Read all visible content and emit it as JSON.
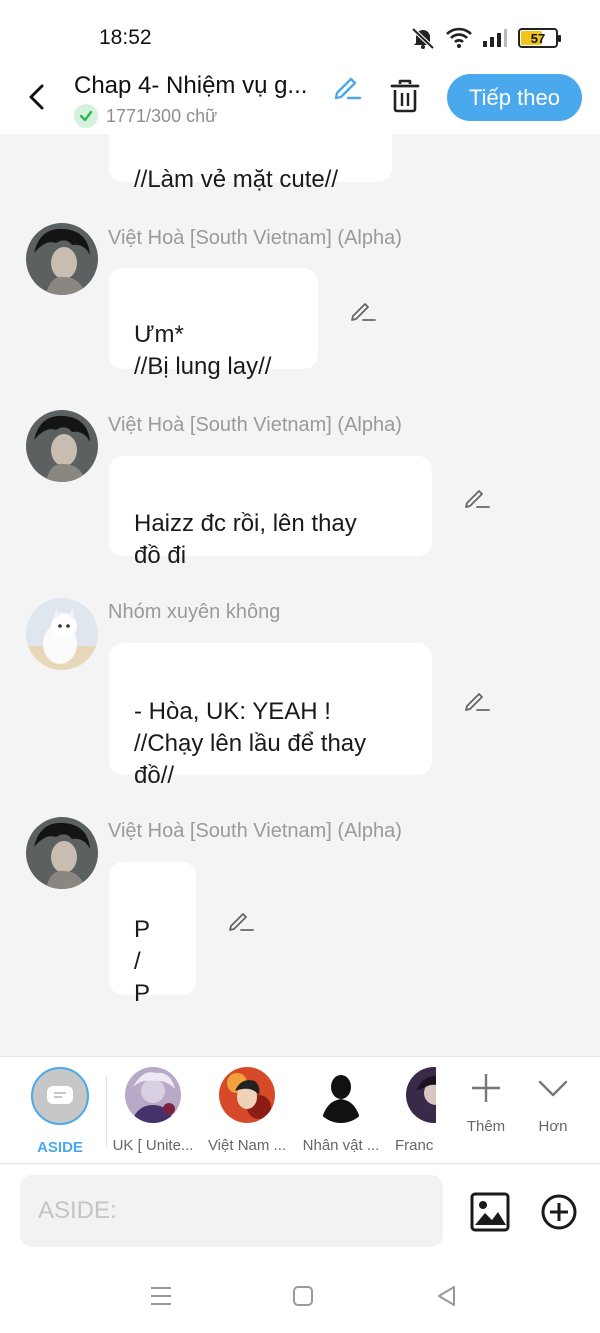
{
  "status_bar": {
    "time": "18:52",
    "battery": "57",
    "battery_level": 0.57,
    "icons": [
      "bell-muted-icon",
      "wifi-icon",
      "signal-icon",
      "battery-icon"
    ]
  },
  "header": {
    "title": "Chap 4- Nhiệm vụ g...",
    "word_count": "1771/300 chữ",
    "next_label": "Tiếp theo",
    "accent_color": "#4aa8ec"
  },
  "messages": [
    {
      "sender": "",
      "text": "//Làm vẻ mặt cute//",
      "editable": false
    },
    {
      "sender": "Việt Hoà [South Vietnam] (Alpha)",
      "text": "Ưm*\n//Bị lung lay//",
      "editable": true
    },
    {
      "sender": "Việt Hoà [South Vietnam] (Alpha)",
      "text": "Haizz đc rồi, lên thay\nđồ đi",
      "editable": true
    },
    {
      "sender": "Nhóm xuyên không",
      "text": "- Hòa, UK: YEAH !\n//Chạy lên lầu để thay\nđồ//",
      "editable": true
    },
    {
      "sender": "Việt Hoà [South Vietnam] (Alpha)",
      "text": "P\n   /\nP",
      "editable": true
    }
  ],
  "characters": [
    {
      "label": "ASIDE",
      "selected": true
    },
    {
      "label": "UK [ Unite..."
    },
    {
      "label": "Việt Nam ..."
    },
    {
      "label": "Nhân vật ..."
    },
    {
      "label": "Franc"
    }
  ],
  "tools": {
    "add_label": "Thêm",
    "more_label": "Hơn"
  },
  "input": {
    "placeholder": "ASIDE:"
  }
}
